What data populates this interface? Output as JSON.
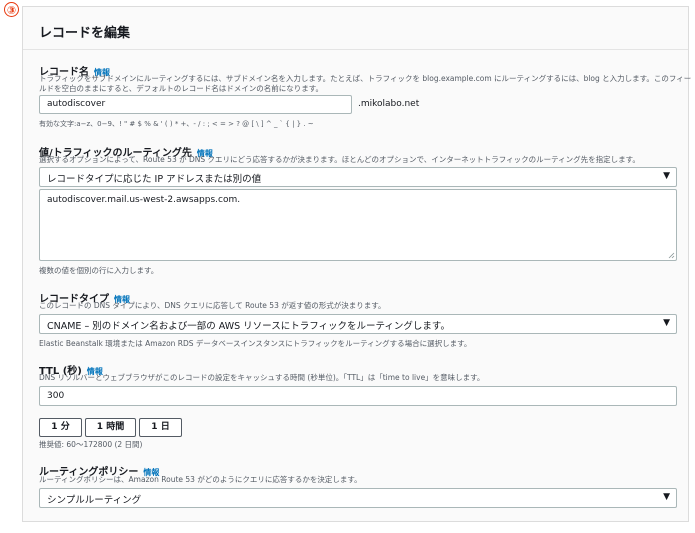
{
  "step_badge": "③",
  "panel": {
    "title": "レコードを編集"
  },
  "info_label": "情報",
  "record_name": {
    "label": "レコード名",
    "description_line1": "トラフィックをサブドメインにルーティングするには、サブドメイン名を入力します。たとえば、トラフィックを blog.example.com にルーティングするには、blog と入力します。このフィー",
    "description_line2": "ルドを空白のままにすると、デフォルトのレコード名はドメインの名前になります。",
    "value": "autodiscover",
    "domain_suffix": ".mikolabo.net",
    "allowed_chars": "有効な文字:a−z、0−9、! \" # $ % & ' ( ) * +、- / : ; < = > ? @ [ \\ ] ^ _ ` { | } . ~"
  },
  "route_value": {
    "label": "値/トラフィックのルーティング先",
    "description": "選択するオプションによって、Route 53 が DNS クエリにどう応答するかが決まります。ほとんどのオプションで、インターネットトラフィックのルーティング先を指定します。",
    "selected": "レコードタイプに応じた IP アドレスまたは別の値",
    "textarea_value": "autodiscover.mail.us-west-2.awsapps.com.",
    "hint": "複数の値を個別の行に入力します。"
  },
  "record_type": {
    "label": "レコードタイプ",
    "description": "このレコードの DNS タイプにより、DNS クエリに応答して Route 53 が返す値の形式が決まります。",
    "selected": "CNAME – 別のドメイン名および一部の AWS リソースにトラフィックをルーティングします。",
    "hint": "Elastic Beanstalk 環境または Amazon RDS データベースインスタンスにトラフィックをルーティングする場合に選択します。"
  },
  "ttl": {
    "label": "TTL (秒)",
    "description": "DNS リゾルバーとウェブブラウザがこのレコードの設定をキャッシュする時間 (秒単位)。「TTL」は「time to live」を意味します。",
    "value": "300",
    "buttons": [
      "1 分",
      "1 時間",
      "1 日"
    ],
    "recommended": "推奨値: 60〜172800 (2 日間)"
  },
  "routing_policy": {
    "label": "ルーティングポリシー",
    "description": "ルーティングポリシーは、Amazon Route 53 がどのようにクエリに応答するかを決定します。",
    "selected": "シンプルルーティング"
  },
  "colors": {
    "badge": "#e8380d",
    "info_link": "#0073bb",
    "text": "#16191f",
    "secondary_text": "#545b64",
    "input_border": "#aab7b8"
  },
  "icons": {
    "dropdown": "caret-down-icon",
    "resize": "resize-grip-icon"
  }
}
